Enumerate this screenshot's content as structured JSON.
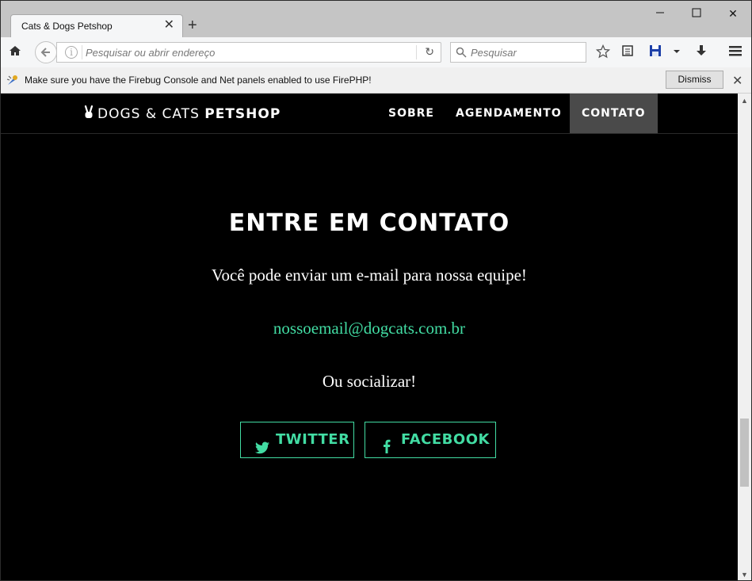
{
  "browser": {
    "tab_title": "Cats & Dogs Petshop",
    "tab_close": "✕",
    "new_tab": "+",
    "window_minimize": "—",
    "window_maximize": "☐",
    "window_close": "✕",
    "url_placeholder": "Pesquisar ou abrir endereço",
    "search_placeholder": "Pesquisar",
    "reload_icon": "↻",
    "home_icon": "⌂",
    "back_icon": "←"
  },
  "notification": {
    "text": "Make sure you have the Firebug Console and Net panels enabled to use FirePHP!",
    "dismiss_label": "Dismiss",
    "close_icon": "✕"
  },
  "site": {
    "brand_part1": "DOGS & CATS ",
    "brand_part2": "PETSHOP",
    "nav": {
      "sobre": "SOBRE",
      "agendamento": "AGENDAMENTO",
      "contato": "CONTATO"
    },
    "contact": {
      "heading": "ENTRE EM CONTATO",
      "intro": "Você pode enviar um e-mail para nossa equipe!",
      "email": "nossoemail@dogcats.com.br",
      "social_text": "Ou socializar!",
      "twitter_label": "TWITTER",
      "facebook_label": "FACEBOOK"
    }
  },
  "colors": {
    "accent": "#42dca3",
    "page_background": "#000000",
    "nav_active_bg": "#4a4a4a"
  },
  "icons": {
    "brand": "peace-hand-icon",
    "twitter": "twitter-bird-icon",
    "facebook": "facebook-f-icon"
  }
}
